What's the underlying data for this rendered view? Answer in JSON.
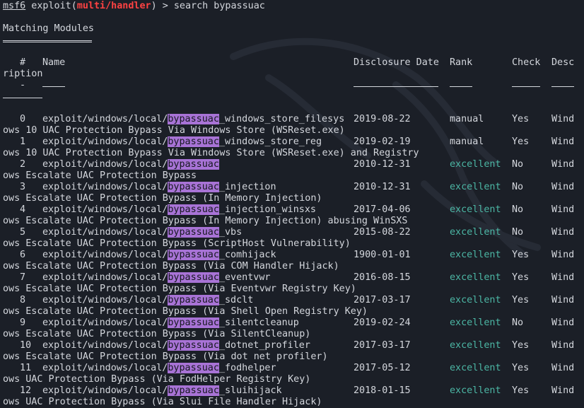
{
  "prompt": {
    "prefix": "msf6",
    "open": " exploit(",
    "module": "multi/handler",
    "close": ") > ",
    "command": "search bypassuac"
  },
  "section_title": "Matching Modules",
  "section_underline": "================",
  "headers": {
    "num": "#",
    "name": "Name",
    "date": "Disclosure Date",
    "rank": "Rank",
    "check": "Check",
    "desc": "Desc",
    "desc_wrap": "ription"
  },
  "header_dashes": {
    "num": "-",
    "name": "----",
    "date": "---------------",
    "rank": "----",
    "check": "-----",
    "desc": "----",
    "desc_wrap": "-------"
  },
  "highlight_term": "bypassuac",
  "modules": [
    {
      "num": "0",
      "path": "exploit/windows/local/",
      "suffix": "_windows_store_filesys",
      "date": "2019-08-22",
      "rank": "manual",
      "check": "Yes",
      "desc_start": "Wind",
      "desc_rest": "ows 10 UAC Protection Bypass Via Windows Store (WSReset.exe)"
    },
    {
      "num": "1",
      "path": "exploit/windows/local/",
      "suffix": "_windows_store_reg",
      "date": "2019-02-19",
      "rank": "manual",
      "check": "Yes",
      "desc_start": "Wind",
      "desc_rest": "ows 10 UAC Protection Bypass Via Windows Store (WSReset.exe) and Registry"
    },
    {
      "num": "2",
      "path": "exploit/windows/local/",
      "suffix": "",
      "date": "2010-12-31",
      "rank": "excellent",
      "check": "No",
      "desc_start": "Wind",
      "desc_rest": "ows Escalate UAC Protection Bypass"
    },
    {
      "num": "3",
      "path": "exploit/windows/local/",
      "suffix": "_injection",
      "date": "2010-12-31",
      "rank": "excellent",
      "check": "No",
      "desc_start": "Wind",
      "desc_rest": "ows Escalate UAC Protection Bypass (In Memory Injection)"
    },
    {
      "num": "4",
      "path": "exploit/windows/local/",
      "suffix": "_injection_winsxs",
      "date": "2017-04-06",
      "rank": "excellent",
      "check": "No",
      "desc_start": "Wind",
      "desc_rest": "ows Escalate UAC Protection Bypass (In Memory Injection) abusing WinSXS"
    },
    {
      "num": "5",
      "path": "exploit/windows/local/",
      "suffix": "_vbs",
      "date": "2015-08-22",
      "rank": "excellent",
      "check": "No",
      "desc_start": "Wind",
      "desc_rest": "ows Escalate UAC Protection Bypass (ScriptHost Vulnerability)"
    },
    {
      "num": "6",
      "path": "exploit/windows/local/",
      "suffix": "_comhijack",
      "date": "1900-01-01",
      "rank": "excellent",
      "check": "Yes",
      "desc_start": "Wind",
      "desc_rest": "ows Escalate UAC Protection Bypass (Via COM Handler Hijack)"
    },
    {
      "num": "7",
      "path": "exploit/windows/local/",
      "suffix": "_eventvwr",
      "date": "2016-08-15",
      "rank": "excellent",
      "check": "Yes",
      "desc_start": "Wind",
      "desc_rest": "ows Escalate UAC Protection Bypass (Via Eventvwr Registry Key)"
    },
    {
      "num": "8",
      "path": "exploit/windows/local/",
      "suffix": "_sdclt",
      "date": "2017-03-17",
      "rank": "excellent",
      "check": "Yes",
      "desc_start": "Wind",
      "desc_rest": "ows Escalate UAC Protection Bypass (Via Shell Open Registry Key)"
    },
    {
      "num": "9",
      "path": "exploit/windows/local/",
      "suffix": "_silentcleanup",
      "date": "2019-02-24",
      "rank": "excellent",
      "check": "No",
      "desc_start": "Wind",
      "desc_rest": "ows Escalate UAC Protection Bypass (Via SilentCleanup)"
    },
    {
      "num": "10",
      "path": "exploit/windows/local/",
      "suffix": "_dotnet_profiler",
      "date": "2017-03-17",
      "rank": "excellent",
      "check": "Yes",
      "desc_start": "Wind",
      "desc_rest": "ows Escalate UAC Protection Bypass (Via dot net profiler)"
    },
    {
      "num": "11",
      "path": "exploit/windows/local/",
      "suffix": "_fodhelper",
      "date": "2017-05-12",
      "rank": "excellent",
      "check": "Yes",
      "desc_start": "Wind",
      "desc_rest": "ows UAC Protection Bypass (Via FodHelper Registry Key)"
    },
    {
      "num": "12",
      "path": "exploit/windows/local/",
      "suffix": "_sluihijack",
      "date": "2018-01-15",
      "rank": "excellent",
      "check": "Yes",
      "desc_start": "Wind",
      "desc_rest": "ows UAC Protection Bypass (Via Slui File Handler Hijack)"
    }
  ],
  "colors": {
    "background": "#1b1f27",
    "text": "#d4d7dd",
    "prompt_module": "#ff4242",
    "highlight_bg": "#a873d6",
    "rank_excellent": "#4cb7a5"
  }
}
